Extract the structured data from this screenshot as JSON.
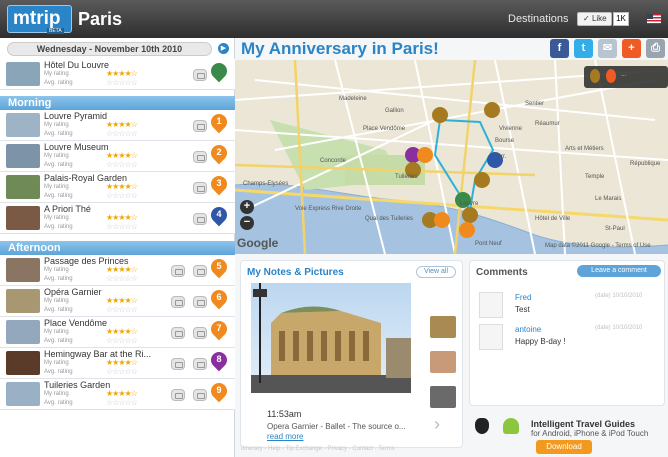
{
  "header": {
    "logo": "mtrip",
    "logo_badge": "BETA",
    "city": "Paris",
    "destinations": "Destinations",
    "like_label": "Like",
    "like_count": "1K",
    "flag_icon": "us-flag-icon"
  },
  "left": {
    "date": "Wednesday - November 10th 2010",
    "rating_label": "My rating",
    "avg_label": "Avg. rating",
    "hotel": {
      "name": "Hôtel Du Louvre",
      "thumb_color": "#8aa4b8",
      "pin_color": "#3a8a4a"
    },
    "sections": {
      "morning": "Morning",
      "afternoon": "Afternoon"
    },
    "morning": [
      {
        "name": "Louvre Pyramid",
        "num": "1",
        "pin_color": "#f08a1e",
        "thumb_color": "#9fb3c6",
        "my_stars": 0
      },
      {
        "name": "Louvre Museum",
        "num": "2",
        "pin_color": "#f08a1e",
        "thumb_color": "#7d93a8",
        "my_stars": 0
      },
      {
        "name": "Palais-Royal Garden",
        "num": "3",
        "pin_color": "#f08a1e",
        "thumb_color": "#6f8a56",
        "my_stars": 0
      },
      {
        "name": "A Priori Thé",
        "num": "4",
        "pin_color": "#2f57a8",
        "thumb_color": "#7a5a44",
        "my_stars": 0
      }
    ],
    "afternoon": [
      {
        "name": "Passage des Princes",
        "num": "5",
        "pin_color": "#f08a1e",
        "thumb_color": "#8a7462",
        "my_stars": 0
      },
      {
        "name": "Opéra Garnier",
        "num": "6",
        "pin_color": "#f08a1e",
        "thumb_color": "#a89872",
        "my_stars": 0
      },
      {
        "name": "Place Vendôme",
        "num": "7",
        "pin_color": "#f08a1e",
        "thumb_color": "#93a8bd",
        "my_stars": 0
      },
      {
        "name": "Hemingway Bar at the Ri...",
        "num": "8",
        "pin_color": "#8a2fa0",
        "thumb_color": "#5a3a28",
        "my_stars": 0
      },
      {
        "name": "Tuileries Garden",
        "num": "9",
        "pin_color": "#f08a1e",
        "thumb_color": "#9ab0c4",
        "my_stars": 0
      }
    ]
  },
  "main": {
    "title": "My Anniversary in Paris!",
    "share": [
      {
        "icon": "facebook-icon",
        "glyph": "f",
        "color": "#3b5998"
      },
      {
        "icon": "twitter-icon",
        "glyph": "t",
        "color": "#33aee8"
      },
      {
        "icon": "email-icon",
        "glyph": "✉",
        "color": "#b8c4d0"
      },
      {
        "icon": "add-icon",
        "glyph": "+",
        "color": "#f05a24"
      },
      {
        "icon": "print-icon",
        "glyph": "⎙",
        "color": "#9aa4ae"
      }
    ],
    "map": {
      "legend_text": "...",
      "zoom_in": "+",
      "zoom_out": "−",
      "google": "Google",
      "mapdata": "Map data ©2011 Google - Terms of Use",
      "street_labels": [
        "Madeleine",
        "Gallion",
        "Place Vendôme",
        "Concorde",
        "Champs-Elysées",
        "Tuileries",
        "Voie Express Rive Droite",
        "Quai des Tuileries",
        "Louvre",
        "Pont Neuf",
        "Vivienne",
        "Bourse",
        "Réaumur",
        "Sentier",
        "Arts et Métiers",
        "République",
        "Le Marais",
        "Temple",
        "Hôtel de Ville",
        "St-Paul",
        "Arr."
      ]
    },
    "notes": {
      "title": "My Notes & Pictures",
      "view_all": "View all",
      "time": "11:53am",
      "caption": "Opera Garnier - Ballet - The source o...",
      "read_more": "read more"
    },
    "comments": {
      "title": "Comments",
      "leave": "Leave a comment",
      "items": [
        {
          "author": "Fred",
          "text": "Test",
          "date": "(date) 10/10/2010"
        },
        {
          "author": "antoine",
          "text": "Happy B-day !",
          "date": "(date) 10/10/2010"
        }
      ]
    },
    "promo": {
      "title": "Intelligent Travel Guides",
      "subtitle": "for Android, iPhone & iPod Touch",
      "download": "Download"
    },
    "footer": "Itinerary - Help - Tip Exchange - Privacy - Contact - Terms"
  }
}
